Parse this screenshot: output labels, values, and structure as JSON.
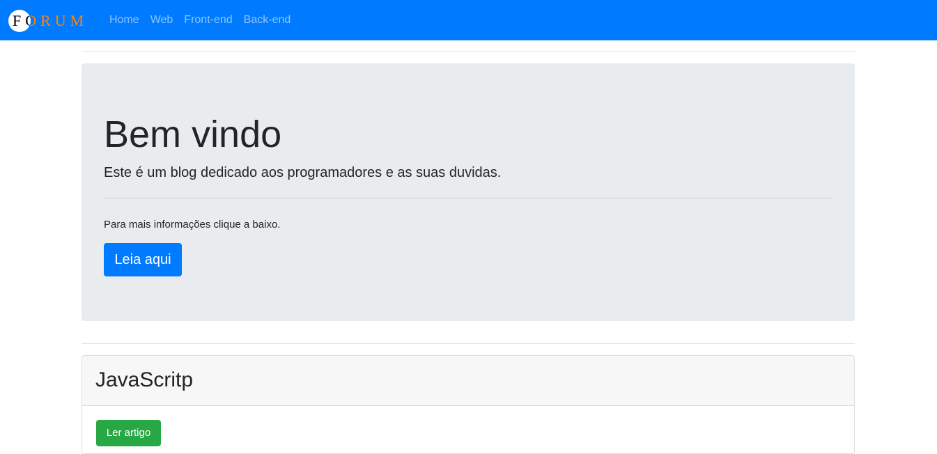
{
  "navbar": {
    "brand": "FORUM",
    "links": [
      "Home",
      "Web",
      "Front-end",
      "Back-end"
    ]
  },
  "jumbotron": {
    "title": "Bem vindo",
    "lead": "Este é um blog dedicado aos programadores e as suas duvidas.",
    "text": "Para mais informações clique a baixo.",
    "button_label": "Leia aqui"
  },
  "card": {
    "title": "JavaScritp",
    "button_label": "Ler artigo"
  },
  "colors": {
    "navbar": "#007bff",
    "primary_button": "#007bff",
    "success_button": "#28a745",
    "jumbotron_bg": "#e9ecef",
    "card_header_bg": "#f7f7f7"
  }
}
